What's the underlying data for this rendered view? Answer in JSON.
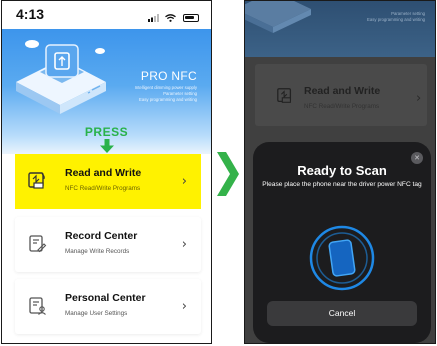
{
  "left_screen": {
    "status_bar": {
      "time": "4:13"
    },
    "hero": {
      "title": "PRO NFC",
      "tagline_lines": [
        "Intelligent dimming power supply",
        "Parameter setting",
        "Easy programming and writing"
      ]
    },
    "press_label": "PRESS",
    "menu": [
      {
        "title": "Read and Write",
        "subtitle": "NFC Read/Write Programs",
        "highlighted": true,
        "icon": "nfc-read-write-icon"
      },
      {
        "title": "Record Center",
        "subtitle": "Manage Write Records",
        "highlighted": false,
        "icon": "record-edit-icon"
      },
      {
        "title": "Personal Center",
        "subtitle": "Manage User Settings",
        "highlighted": false,
        "icon": "user-document-icon"
      }
    ]
  },
  "right_screen": {
    "hero_lines": [
      "Parameter setting",
      "Easy programming and writing"
    ],
    "background_card": {
      "title": "Read and Write",
      "subtitle": "NFC Read/Write Programs"
    },
    "scan_sheet": {
      "title": "Ready to Scan",
      "message": "Please place the phone near the driver power NFC tag",
      "cancel_label": "Cancel"
    }
  },
  "colors": {
    "highlight": "#fff200",
    "press_green": "#29b24a",
    "arrow_green": "#34b24a",
    "scan_blue": "#1e88e5",
    "hero_blue": "#3d95ec"
  }
}
